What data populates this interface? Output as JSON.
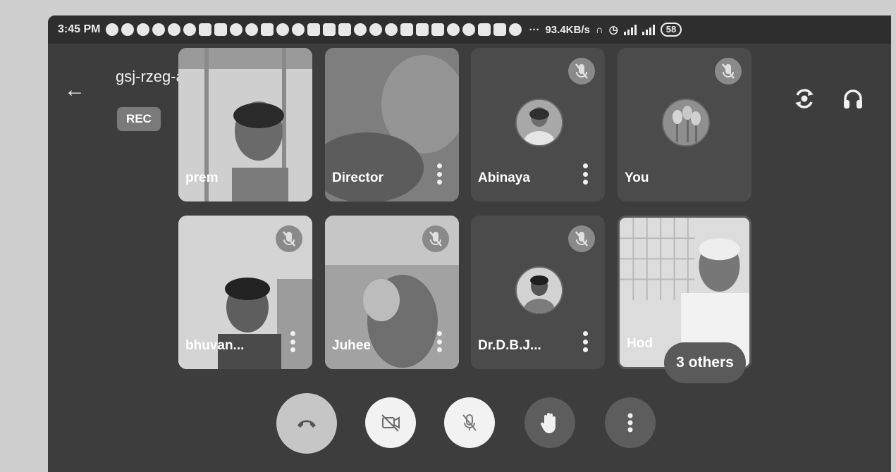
{
  "status_bar": {
    "time": "3:45 PM",
    "network_speed": "93.4KB/s",
    "battery": "58",
    "more_indicator": "···"
  },
  "meeting": {
    "title": "gsj-rzeg-asa",
    "recording_badge": "REC"
  },
  "participants": [
    {
      "name": "prem",
      "muted": false
    },
    {
      "name": "Director",
      "muted": false
    },
    {
      "name": "Abinaya",
      "muted": true
    },
    {
      "name": "You",
      "muted": true
    },
    {
      "name": "bhuvan...",
      "muted": true
    },
    {
      "name": "Juhee",
      "muted": true
    },
    {
      "name": "Dr.D.B.J...",
      "muted": true
    },
    {
      "name": "Hod",
      "muted": false
    }
  ],
  "others_count_label": "3 others",
  "controls": {
    "end_call": "end-call-icon",
    "camera": "video-off-icon",
    "microphone": "mic-off-icon",
    "raise_hand": "hand-icon",
    "more": "more-vert-icon"
  }
}
